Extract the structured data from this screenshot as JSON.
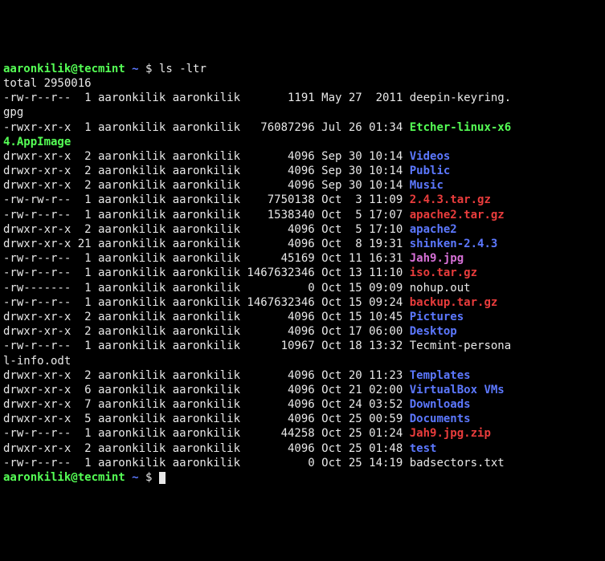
{
  "prompt": {
    "user_host": "aaronkilik@tecmint",
    "cwd": "~",
    "sigil": "$"
  },
  "command": "ls -ltr",
  "total_line": "total 2950016",
  "rows": [
    {
      "perm": "-rw-r--r--",
      "links": " 1",
      "owner": "aaronkilik",
      "group": "aaronkilik",
      "size": "      1191",
      "date": "May 27  2011",
      "name": "deepin-keyring.gpg",
      "cls": "white",
      "wrap": [
        "deepin-keyring.",
        "gpg"
      ]
    },
    {
      "perm": "-rwxr-xr-x",
      "links": " 1",
      "owner": "aaronkilik",
      "group": "aaronkilik",
      "size": "  76087296",
      "date": "Jul 26 01:34",
      "name": "Etcher-linux-x64.AppImage",
      "cls": "green",
      "wrap": [
        "Etcher-linux-x6",
        "4.AppImage"
      ]
    },
    {
      "perm": "drwxr-xr-x",
      "links": " 2",
      "owner": "aaronkilik",
      "group": "aaronkilik",
      "size": "      4096",
      "date": "Sep 30 10:14",
      "name": "Videos",
      "cls": "blue"
    },
    {
      "perm": "drwxr-xr-x",
      "links": " 2",
      "owner": "aaronkilik",
      "group": "aaronkilik",
      "size": "      4096",
      "date": "Sep 30 10:14",
      "name": "Public",
      "cls": "blue"
    },
    {
      "perm": "drwxr-xr-x",
      "links": " 2",
      "owner": "aaronkilik",
      "group": "aaronkilik",
      "size": "      4096",
      "date": "Sep 30 10:14",
      "name": "Music",
      "cls": "blue"
    },
    {
      "perm": "-rw-rw-r--",
      "links": " 1",
      "owner": "aaronkilik",
      "group": "aaronkilik",
      "size": "   7750138",
      "date": "Oct  3 11:09",
      "name": "2.4.3.tar.gz",
      "cls": "red"
    },
    {
      "perm": "-rw-r--r--",
      "links": " 1",
      "owner": "aaronkilik",
      "group": "aaronkilik",
      "size": "   1538340",
      "date": "Oct  5 17:07",
      "name": "apache2.tar.gz",
      "cls": "red"
    },
    {
      "perm": "drwxr-xr-x",
      "links": " 2",
      "owner": "aaronkilik",
      "group": "aaronkilik",
      "size": "      4096",
      "date": "Oct  5 17:10",
      "name": "apache2",
      "cls": "blue"
    },
    {
      "perm": "drwxr-xr-x",
      "links": "21",
      "owner": "aaronkilik",
      "group": "aaronkilik",
      "size": "      4096",
      "date": "Oct  8 19:31",
      "name": "shinken-2.4.3",
      "cls": "blue"
    },
    {
      "perm": "-rw-r--r--",
      "links": " 1",
      "owner": "aaronkilik",
      "group": "aaronkilik",
      "size": "     45169",
      "date": "Oct 11 16:31",
      "name": "Jah9.jpg",
      "cls": "mag"
    },
    {
      "perm": "-rw-r--r--",
      "links": " 1",
      "owner": "aaronkilik",
      "group": "aaronkilik",
      "size": "1467632346",
      "date": "Oct 13 11:10",
      "name": "iso.tar.gz",
      "cls": "red"
    },
    {
      "perm": "-rw-------",
      "links": " 1",
      "owner": "aaronkilik",
      "group": "aaronkilik",
      "size": "         0",
      "date": "Oct 15 09:09",
      "name": "nohup.out",
      "cls": "white"
    },
    {
      "perm": "-rw-r--r--",
      "links": " 1",
      "owner": "aaronkilik",
      "group": "aaronkilik",
      "size": "1467632346",
      "date": "Oct 15 09:24",
      "name": "backup.tar.gz",
      "cls": "red"
    },
    {
      "perm": "drwxr-xr-x",
      "links": " 2",
      "owner": "aaronkilik",
      "group": "aaronkilik",
      "size": "      4096",
      "date": "Oct 15 10:45",
      "name": "Pictures",
      "cls": "blue"
    },
    {
      "perm": "drwxr-xr-x",
      "links": " 2",
      "owner": "aaronkilik",
      "group": "aaronkilik",
      "size": "      4096",
      "date": "Oct 17 06:00",
      "name": "Desktop",
      "cls": "blue"
    },
    {
      "perm": "-rw-r--r--",
      "links": " 1",
      "owner": "aaronkilik",
      "group": "aaronkilik",
      "size": "     10967",
      "date": "Oct 18 13:32",
      "name": "Tecmint-personal-info.odt",
      "cls": "white",
      "wrap": [
        "Tecmint-persona",
        "l-info.odt"
      ]
    },
    {
      "perm": "drwxr-xr-x",
      "links": " 2",
      "owner": "aaronkilik",
      "group": "aaronkilik",
      "size": "      4096",
      "date": "Oct 20 11:23",
      "name": "Templates",
      "cls": "blue"
    },
    {
      "perm": "drwxr-xr-x",
      "links": " 6",
      "owner": "aaronkilik",
      "group": "aaronkilik",
      "size": "      4096",
      "date": "Oct 21 02:00",
      "name": "VirtualBox VMs",
      "cls": "blue"
    },
    {
      "perm": "drwxr-xr-x",
      "links": " 7",
      "owner": "aaronkilik",
      "group": "aaronkilik",
      "size": "      4096",
      "date": "Oct 24 03:52",
      "name": "Downloads",
      "cls": "blue"
    },
    {
      "perm": "drwxr-xr-x",
      "links": " 5",
      "owner": "aaronkilik",
      "group": "aaronkilik",
      "size": "      4096",
      "date": "Oct 25 00:59",
      "name": "Documents",
      "cls": "blue"
    },
    {
      "perm": "-rw-r--r--",
      "links": " 1",
      "owner": "aaronkilik",
      "group": "aaronkilik",
      "size": "     44258",
      "date": "Oct 25 01:24",
      "name": "Jah9.jpg.zip",
      "cls": "red"
    },
    {
      "perm": "drwxr-xr-x",
      "links": " 2",
      "owner": "aaronkilik",
      "group": "aaronkilik",
      "size": "      4096",
      "date": "Oct 25 01:48",
      "name": "test",
      "cls": "blue"
    },
    {
      "perm": "-rw-r--r--",
      "links": " 1",
      "owner": "aaronkilik",
      "group": "aaronkilik",
      "size": "         0",
      "date": "Oct 25 14:19",
      "name": "badsectors.txt",
      "cls": "white"
    }
  ]
}
